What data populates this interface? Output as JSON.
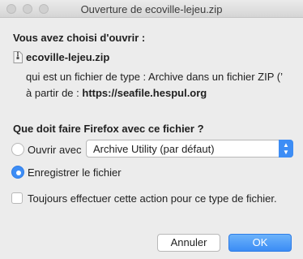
{
  "window": {
    "title": "Ouverture de ecoville-lejeu.zip"
  },
  "dialog": {
    "heading": "Vous avez choisi d'ouvrir :",
    "file_icon": "file-zip-icon",
    "filename": "ecoville-lejeu.zip",
    "type_text": "qui est un fichier de type : Archive dans un fichier ZIP (’",
    "from_label": "à partir de :",
    "from_url": "https://seafile.hespul.org",
    "question": "Que doit faire Firefox avec ce fichier ?",
    "open_with_label": "Ouvrir avec",
    "open_with_selected": "Archive Utility (par défaut)",
    "save_label": "Enregistrer le fichier",
    "selected_option": "save",
    "always_label": "Toujours effectuer cette action pour ce type de fichier.",
    "always_checked": false,
    "cancel_label": "Annuler",
    "ok_label": "OK"
  }
}
